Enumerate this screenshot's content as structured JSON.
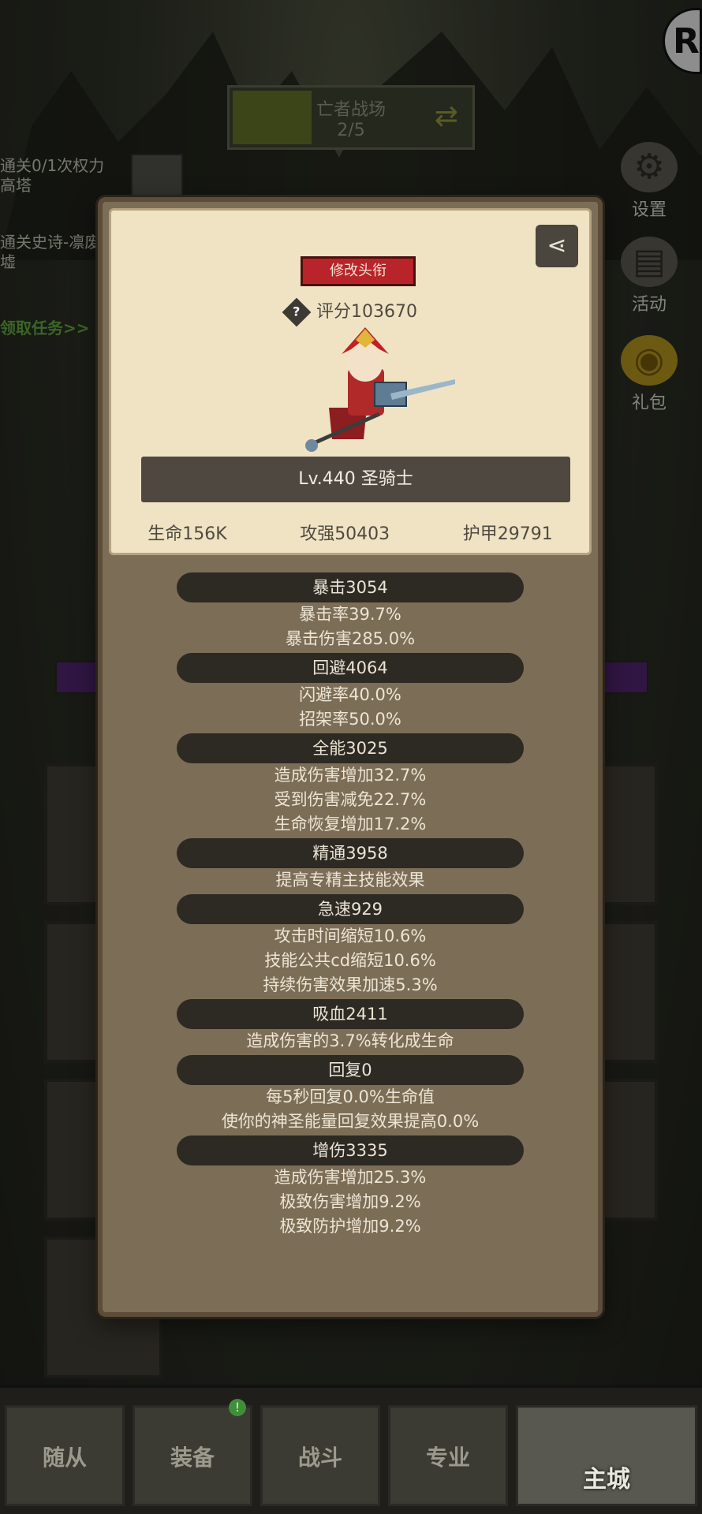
{
  "top_banner": {
    "title": "亡者战场",
    "progress": "2/5"
  },
  "quests": [
    {
      "text": "通关0/1次权力高塔"
    },
    {
      "text": "通关史诗-凛废墟"
    },
    {
      "text": "领取任务>>"
    }
  ],
  "right_menu": [
    {
      "label": "设置",
      "icon": "gear-icon"
    },
    {
      "label": "活动",
      "icon": "scroll-icon"
    },
    {
      "label": "礼包",
      "icon": "giftbag-icon"
    }
  ],
  "logo_text": "R",
  "panel": {
    "title_button": "修改头衔",
    "score": "评分103670",
    "level_class": "Lv.440 圣骑士",
    "hp": "生命156K",
    "attack": "攻强50403",
    "armor": "护甲29791",
    "groups": [
      {
        "header": "暴击3054",
        "lines": [
          "暴击率39.7%",
          "暴击伤害285.0%"
        ]
      },
      {
        "header": "回避4064",
        "lines": [
          "闪避率40.0%",
          "招架率50.0%"
        ]
      },
      {
        "header": "全能3025",
        "lines": [
          "造成伤害增加32.7%",
          "受到伤害减免22.7%",
          "生命恢复增加17.2%"
        ]
      },
      {
        "header": "精通3958",
        "lines": [
          "提高专精主技能效果"
        ]
      },
      {
        "header": "急速929",
        "lines": [
          "攻击时间缩短10.6%",
          "技能公共cd缩短10.6%",
          "持续伤害效果加速5.3%"
        ]
      },
      {
        "header": "吸血2411",
        "lines": [
          "造成伤害的3.7%转化成生命"
        ]
      },
      {
        "header": "回复0",
        "lines": [
          "每5秒回复0.0%生命值",
          "使你的神圣能量回复效果提高0.0%"
        ]
      },
      {
        "header": "增伤3335",
        "lines": [
          "造成伤害增加25.3%",
          "极致伤害增加9.2%",
          "极致防护增加9.2%"
        ]
      }
    ]
  },
  "bottom_nav": [
    {
      "label": "随从"
    },
    {
      "label": "装备",
      "badge": "!"
    },
    {
      "label": "战斗"
    },
    {
      "label": "专业"
    },
    {
      "label": "主城"
    }
  ]
}
